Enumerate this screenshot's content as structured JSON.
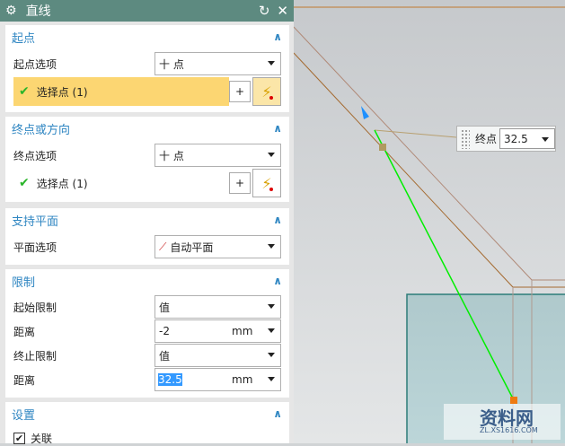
{
  "dialog": {
    "title": "直线",
    "reset_icon": "reset-icon",
    "close_icon": "close-icon"
  },
  "start": {
    "header": "起点",
    "option_label": "起点选项",
    "option_value": "十 点",
    "select_label": "选择点 (1)"
  },
  "end": {
    "header": "终点或方向",
    "option_label": "终点选项",
    "option_value": "十 点",
    "select_label": "选择点 (1)"
  },
  "plane": {
    "header": "支持平面",
    "option_label": "平面选项",
    "option_value": "自动平面"
  },
  "limits": {
    "header": "限制",
    "start_limit_label": "起始限制",
    "start_limit_value": "值",
    "start_distance_label": "距离",
    "start_distance_value": "-2",
    "start_unit": "mm",
    "end_limit_label": "终止限制",
    "end_limit_value": "值",
    "end_distance_label": "距离",
    "end_distance_value": "32.5",
    "end_unit": "mm"
  },
  "settings": {
    "header": "设置",
    "associative_label": "关联",
    "associative_checked": true
  },
  "viewport": {
    "popup_label": "终点",
    "popup_value": "32.5"
  },
  "watermark": {
    "text": "资料网",
    "sub": "ZL.XS1616.COM"
  },
  "colors": {
    "accent": "#2f86c2",
    "title_bar": "#5d8a80",
    "highlight": "#fcd672",
    "line": "#00ee00"
  }
}
